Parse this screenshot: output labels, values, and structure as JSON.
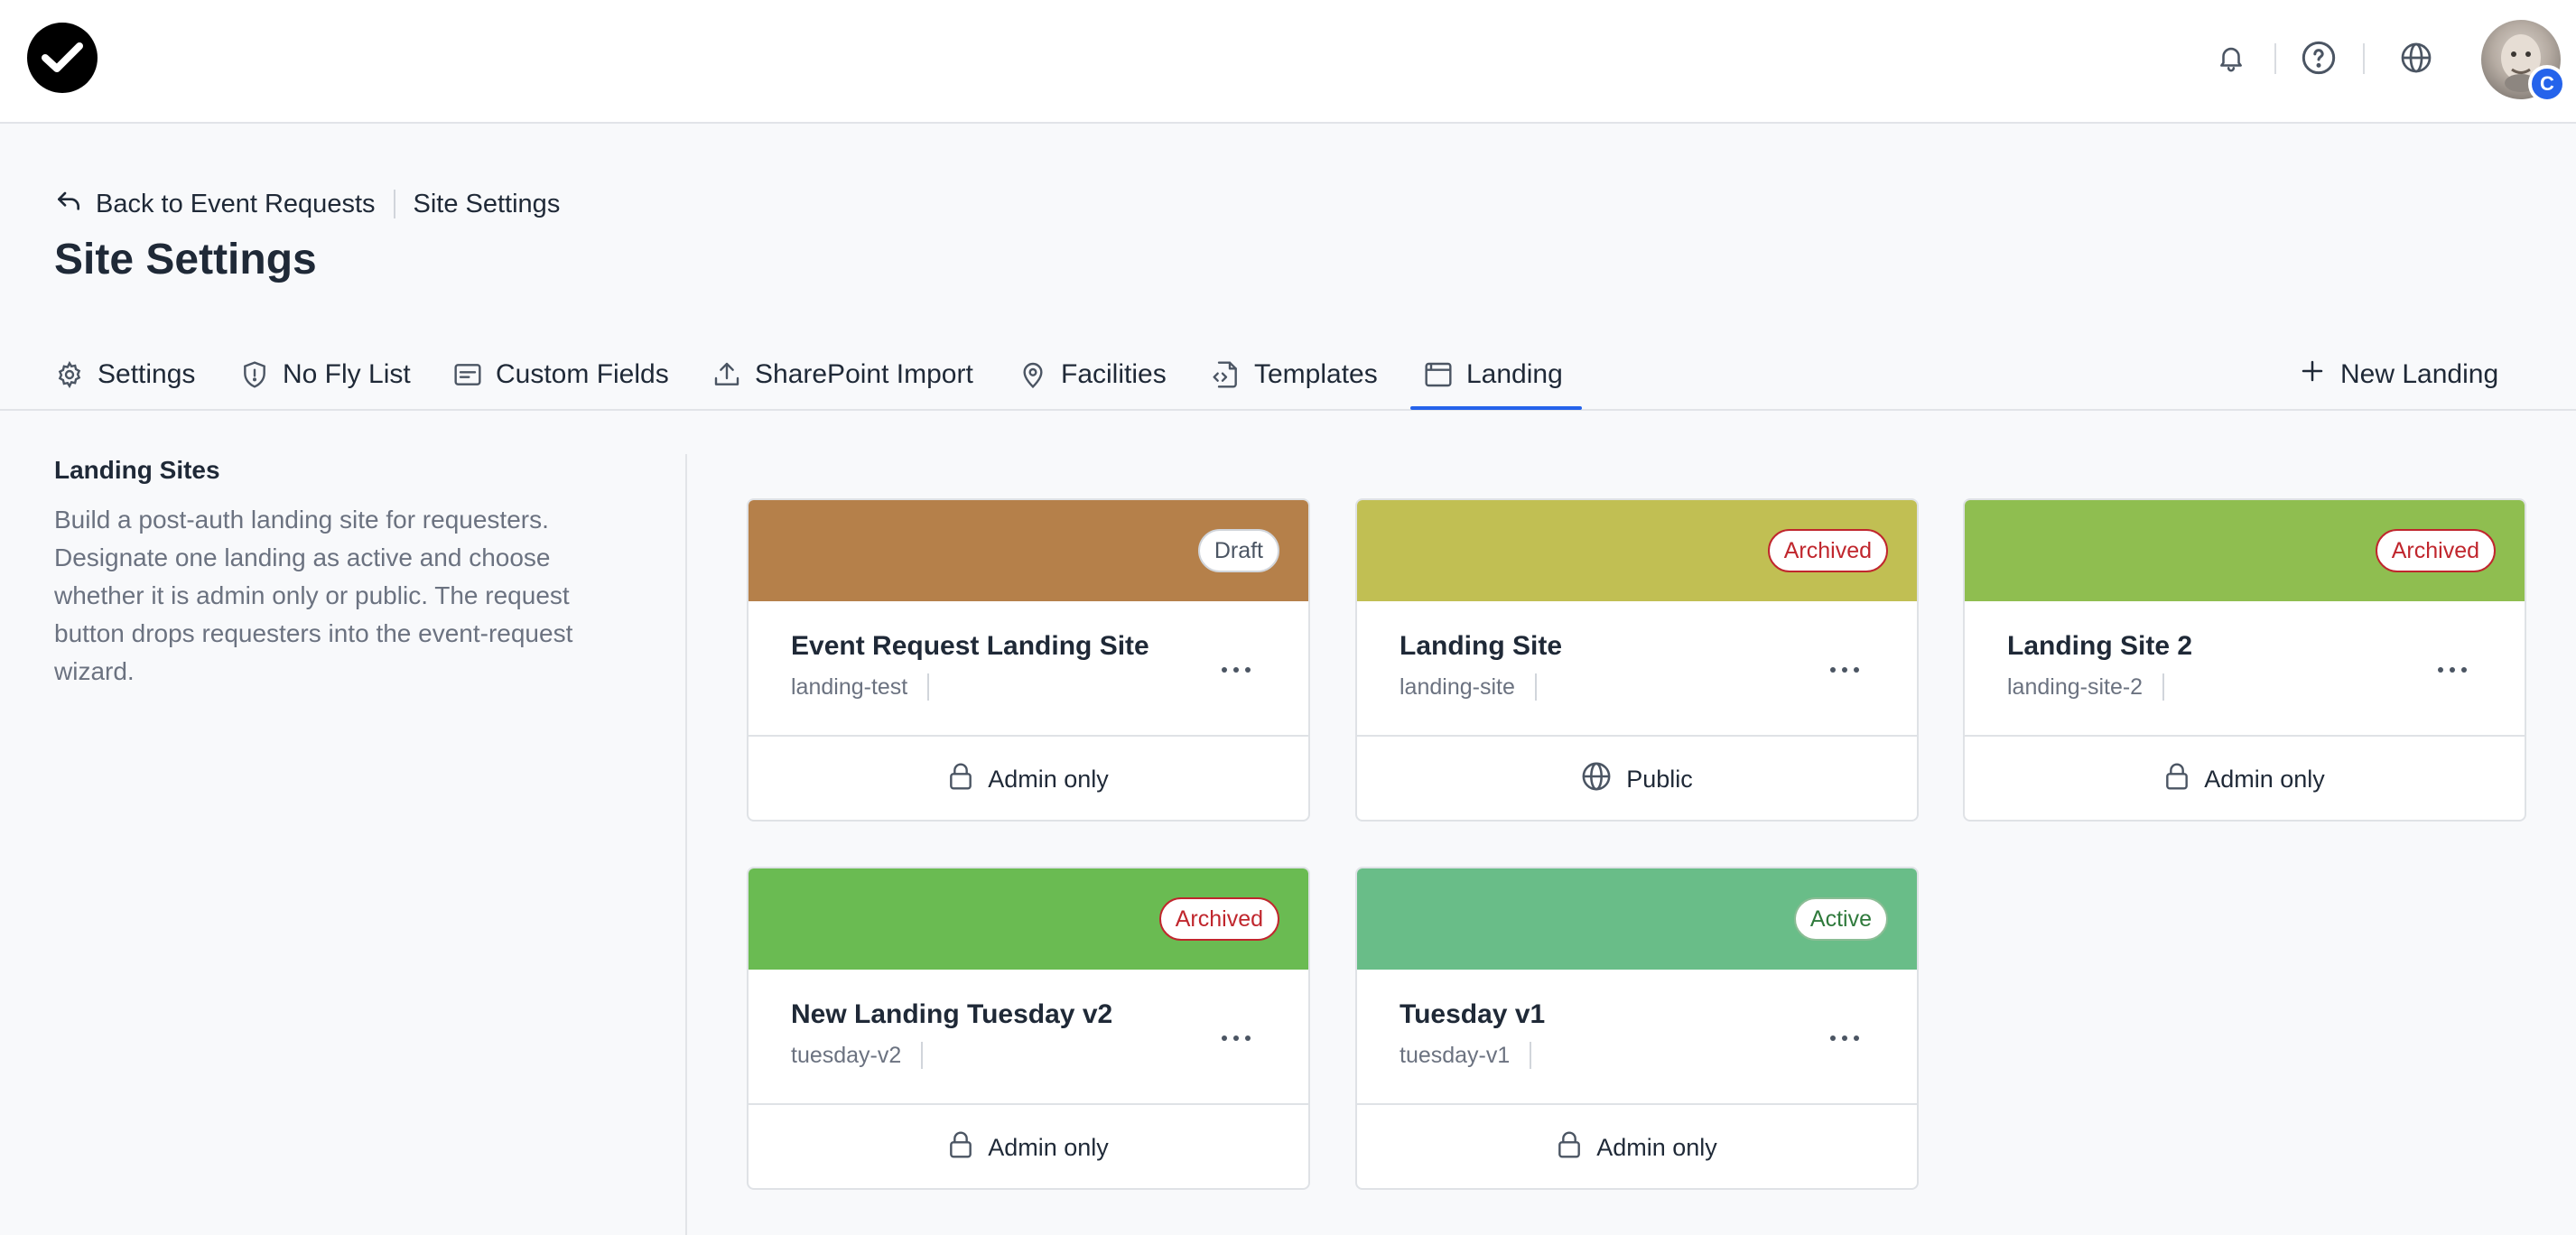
{
  "header": {
    "logo_icon": "checkmark-logo-icon",
    "icons": [
      "bell-icon",
      "help-circle-icon",
      "globe-icon"
    ],
    "avatar_badge": "C"
  },
  "breadcrumb": {
    "back_label": "Back to Event Requests",
    "current": "Site Settings"
  },
  "page_title": "Site Settings",
  "tabs": [
    {
      "label": "Settings",
      "icon": "gear-icon"
    },
    {
      "label": "No Fly List",
      "icon": "shield-alert-icon"
    },
    {
      "label": "Custom Fields",
      "icon": "form-fields-icon"
    },
    {
      "label": "SharePoint Import",
      "icon": "upload-icon"
    },
    {
      "label": "Facilities",
      "icon": "map-pin-icon"
    },
    {
      "label": "Templates",
      "icon": "file-code-icon"
    },
    {
      "label": "Landing",
      "icon": "browser-window-icon",
      "active": true
    }
  ],
  "new_landing_label": "New Landing",
  "left_panel": {
    "heading": "Landing Sites",
    "description": "Build a post-auth landing site for requesters. Designate one landing as active and choose whether it is admin only or public. The request button drops requesters into the event-request wizard."
  },
  "cards": [
    {
      "name": "Event Request Landing Site",
      "slug": "landing-test",
      "status": "Draft",
      "access": "Admin only",
      "color": "#b5804a"
    },
    {
      "name": "Landing Site",
      "slug": "landing-site",
      "status": "Archived",
      "access": "Public",
      "color": "#c1bf53"
    },
    {
      "name": "Landing Site 2",
      "slug": "landing-site-2",
      "status": "Archived",
      "access": "Admin only",
      "color": "#8fbe50"
    },
    {
      "name": "New Landing Tuesday v2",
      "slug": "tuesday-v2",
      "status": "Archived",
      "access": "Admin only",
      "color": "#6abb52"
    },
    {
      "name": "Tuesday v1",
      "slug": "tuesday-v1",
      "status": "Active",
      "access": "Admin only",
      "color": "#69bd88"
    }
  ],
  "colors": {
    "accent": "#2563eb",
    "archived": "#c0262d",
    "active": "#2f7a3c"
  }
}
